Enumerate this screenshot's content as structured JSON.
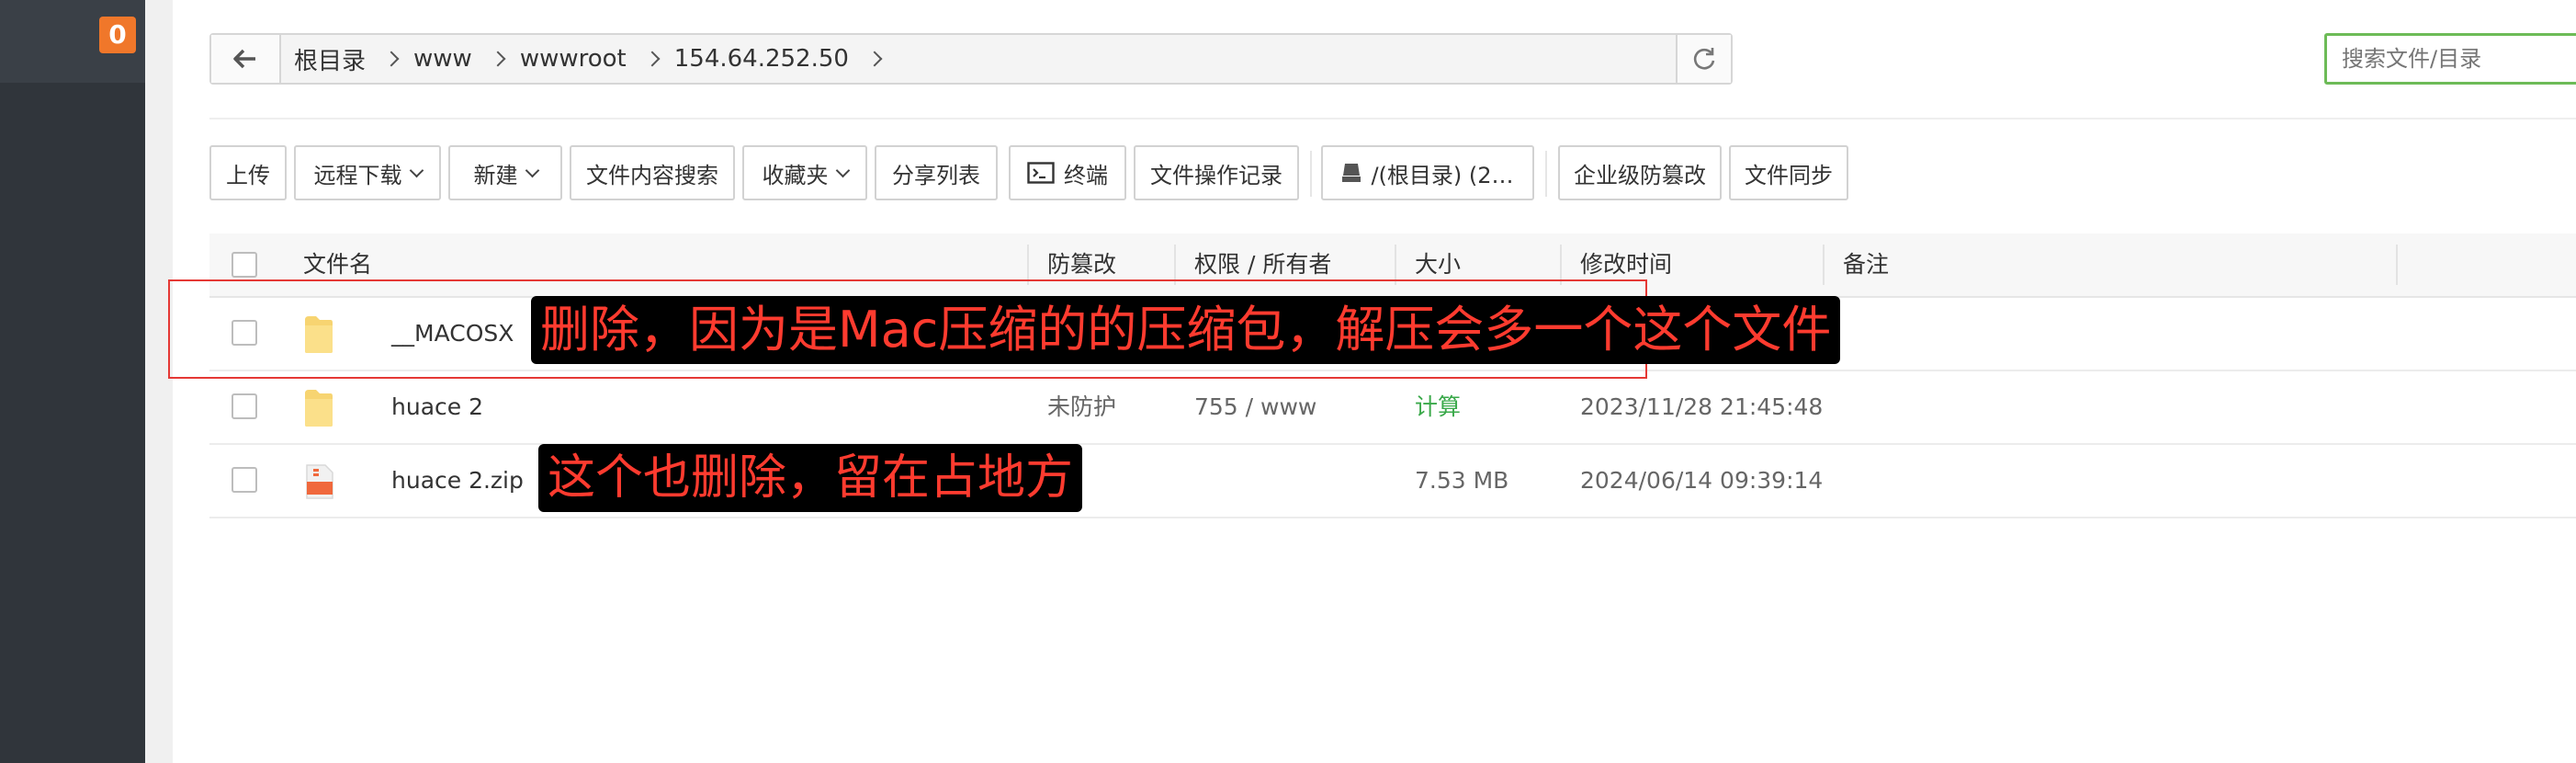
{
  "sidebar": {
    "badge": "0"
  },
  "breadcrumb": [
    "根目录",
    "www",
    "wwwroot",
    "154.64.252.50"
  ],
  "search": {
    "placeholder": "搜索文件/目录"
  },
  "toolbar": {
    "upload": "上传",
    "remote_download": "远程下载",
    "new": "新建",
    "content_search": "文件内容搜索",
    "favorites": "收藏夹",
    "share_list": "分享列表",
    "terminal": "终端",
    "op_log": "文件操作记录",
    "disk": "/(根目录) (2…",
    "tamper_proof": "企业级防篡改",
    "sync": "文件同步"
  },
  "table": {
    "columns": {
      "name": "文件名",
      "protect": "防篡改",
      "perm": "权限 / 所有者",
      "size": "大小",
      "mtime": "修改时间",
      "note": "备注"
    },
    "rows": [
      {
        "name": "__MACOSX",
        "type": "folder",
        "protect": "",
        "perm": "",
        "size": "",
        "mtime": ""
      },
      {
        "name": "huace 2",
        "type": "folder",
        "protect": "未防护",
        "perm": "755 / www",
        "size": "计算",
        "mtime": "2023/11/28 21:45:48"
      },
      {
        "name": "huace 2.zip",
        "type": "zip",
        "protect": "",
        "perm": "",
        "size": "7.53 MB",
        "mtime": "2024/06/14 09:39:14"
      }
    ]
  },
  "annotations": {
    "callout1": "删除，因为是Mac压缩的的压缩包，解压会多一个这个文件",
    "callout2": "这个也删除，留在占地方"
  },
  "colors": {
    "sidebar": "#30353b",
    "badge": "#f0772a",
    "accent_green": "#6dbb57",
    "annotation_red": "#ff3b2f"
  }
}
